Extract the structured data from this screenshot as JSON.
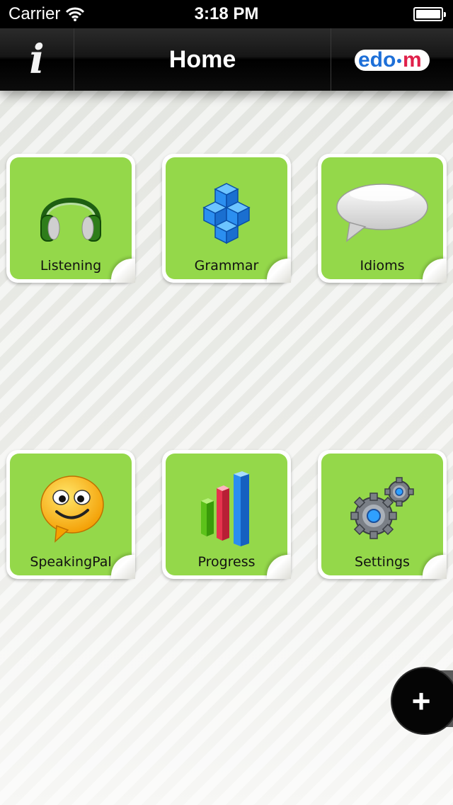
{
  "status_bar": {
    "carrier": "Carrier",
    "time": "3:18 PM"
  },
  "nav": {
    "title": "Home",
    "info_icon": "info-icon",
    "logo_text": "edo·m"
  },
  "tiles": [
    {
      "label": "Listening",
      "icon": "headphones-icon"
    },
    {
      "label": "Grammar",
      "icon": "cubes-icon"
    },
    {
      "label": "Idioms",
      "icon": "speech-bubble-icon"
    },
    {
      "label": "SpeakingPal",
      "icon": "smiley-bubble-icon"
    },
    {
      "label": "Progress",
      "icon": "bar-chart-icon"
    },
    {
      "label": "Settings",
      "icon": "gears-icon"
    }
  ],
  "fab": {
    "label": "+",
    "icon": "plus-icon"
  },
  "colors": {
    "tile_green": "#94d84a",
    "nav_black": "#000000",
    "logo_blue": "#1d6fd8",
    "logo_red": "#e0204a"
  }
}
